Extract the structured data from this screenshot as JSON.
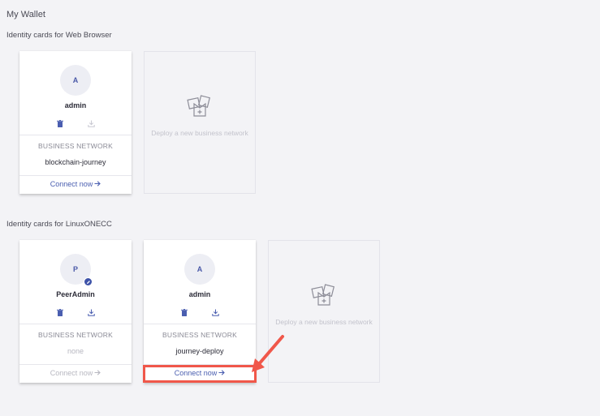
{
  "page": {
    "title": "My Wallet"
  },
  "sections": [
    {
      "heading": "Identity cards for Web Browser",
      "cards": [
        {
          "initial": "A",
          "name": "admin",
          "network_label": "BUSINESS NETWORK",
          "network": "blockchain-journey",
          "connect_label": "Connect now",
          "connect_enabled": true,
          "export_enabled": false
        }
      ],
      "deploy_label": "Deploy a new business network"
    },
    {
      "heading": "Identity cards for LinuxONECC",
      "cards": [
        {
          "initial": "P",
          "name": "PeerAdmin",
          "network_label": "BUSINESS NETWORK",
          "network": "none",
          "connect_label": "Connect now",
          "connect_enabled": false,
          "export_enabled": true,
          "badge": "edit-badge"
        },
        {
          "initial": "A",
          "name": "admin",
          "network_label": "BUSINESS NETWORK",
          "network": "journey-deploy",
          "connect_label": "Connect now",
          "connect_enabled": true,
          "export_enabled": true
        }
      ],
      "deploy_label": "Deploy a new business network"
    }
  ],
  "icons": {
    "delete": "trash-icon",
    "export": "download-icon",
    "arrow": "arrow-right-icon",
    "deploy": "deploy-network-icon"
  },
  "colors": {
    "accent": "#4a5eb0",
    "avatar_bg": "#edeef4",
    "muted": "#b7b7c0",
    "annotation": "#f0574a"
  }
}
